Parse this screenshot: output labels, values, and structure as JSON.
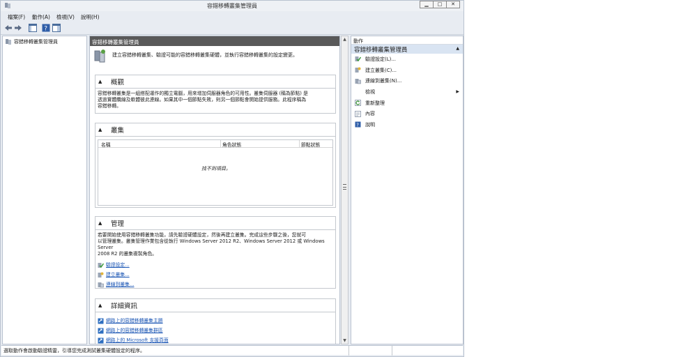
{
  "window": {
    "title": "容錯移轉叢集管理員",
    "minimize": "▁",
    "maximize": "□",
    "close": "✕"
  },
  "menu": [
    "檔案(F)",
    "動作(A)",
    "檢視(V)",
    "說明(H)"
  ],
  "tree": {
    "root": "容錯移轉叢集管理員"
  },
  "center": {
    "header": "容錯移轉叢集管理員",
    "intro": "建立容錯移轉叢集、驗證可能的容錯移轉叢集硬體，並執行容錯移轉叢集的設定變更。",
    "overview": {
      "title": "概觀",
      "lines": [
        "容錯移轉叢集是一組搭配運作的獨立電腦，用來增加伺服器角色的可用性。叢集伺服器 (稱為節點) 是",
        "透過實體纜線及軟體彼此連線。如果其中一個節點失敗，則另一個節點會開始提供服務。此程序稱為",
        "容錯移轉。"
      ]
    },
    "clusters": {
      "title": "叢集",
      "columns": [
        "名稱",
        "角色狀態",
        "節點狀態"
      ],
      "empty": "找不到項目。"
    },
    "management": {
      "title": "管理",
      "lines": [
        "若要開始使用容錯移轉叢集功能，請先驗證硬體設定，然後再建立叢集。完成這些步驟之後，您就可",
        "以管理叢集。叢集管理作業包含從執行 Windows Server 2012 R2、Windows Server 2012 或 Windows Server",
        "2008 R2 的叢集複製角色。"
      ],
      "links": [
        "驗證設定...",
        "建立叢集...",
        "連線到叢集..."
      ]
    },
    "details": {
      "title": "詳細資訊",
      "links": [
        "網路上的容錯移轉叢集主題",
        "網路上的容錯移轉叢集群區",
        "網路上的 Microsoft 支援頁面"
      ]
    }
  },
  "actions": {
    "title": "動作",
    "section": "容錯移轉叢集管理員",
    "items": [
      "驗證設定(L)...",
      "建立叢集(C)...",
      "連線到叢集(N)...",
      "檢視",
      "重新整理",
      "內容",
      "說明"
    ]
  },
  "status": {
    "text": "選取動作會啟動驗證精靈，引導您完成測試叢集硬體設定的程序。"
  },
  "colors": {
    "header_bg": "#595959",
    "section_bg": "#d9e4f2",
    "link": "#1a55b4"
  },
  "icons": [
    "cluster-icon",
    "back-arrow-icon",
    "forward-arrow-icon",
    "console-tree-icon",
    "help-icon",
    "action-pane-icon",
    "validate-icon",
    "create-cluster-icon",
    "connect-icon",
    "refresh-icon",
    "properties-icon",
    "help-book-icon"
  ]
}
